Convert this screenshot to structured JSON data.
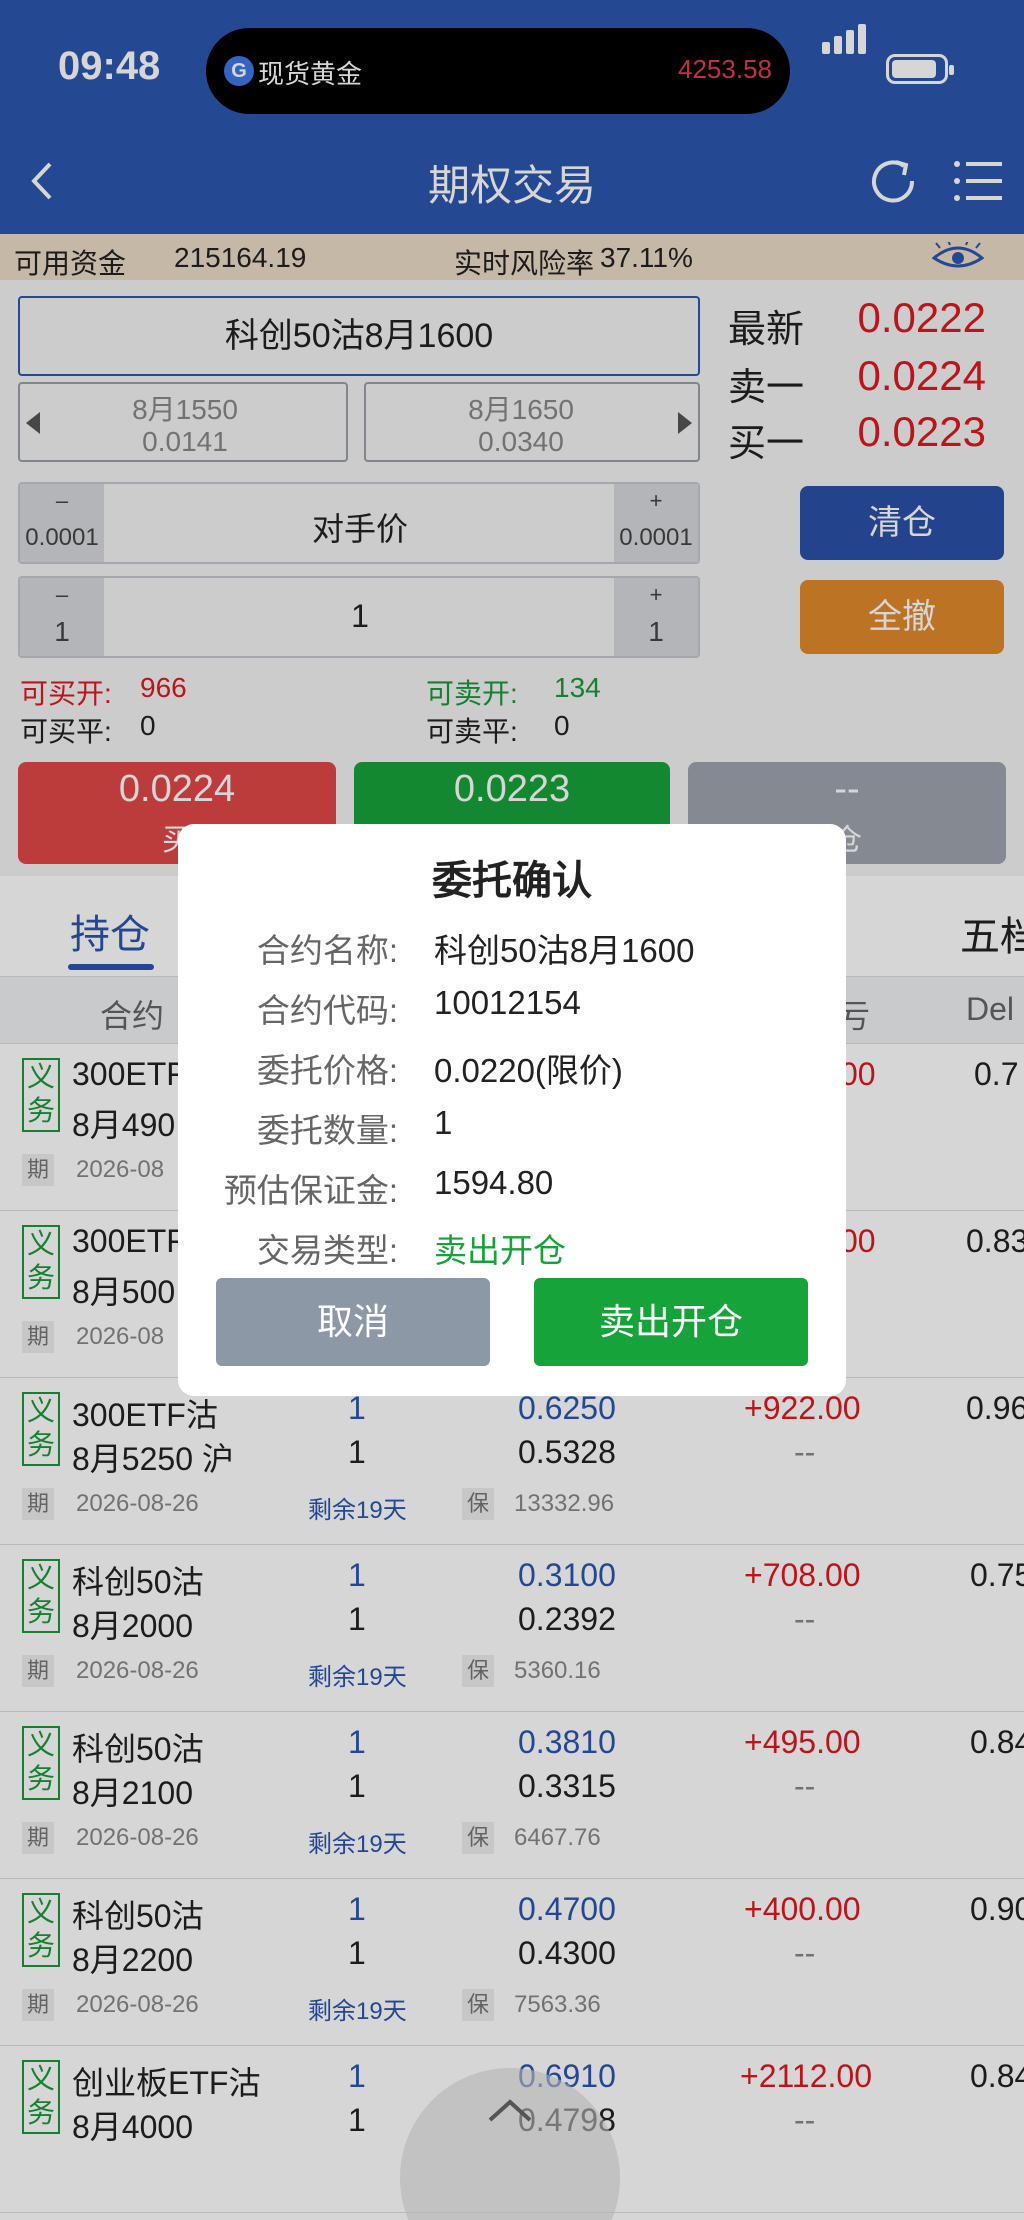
{
  "status": {
    "time": "09:48"
  },
  "island": {
    "label": "现货黄金",
    "price": "4253.58"
  },
  "header": {
    "title": "期权交易"
  },
  "funds": {
    "available_label": "可用资金",
    "available_value": "215164.19",
    "risk_label": "实时风险率",
    "risk_value": "37.11%"
  },
  "contract": {
    "name": "科创50沽8月1600"
  },
  "neighbors": {
    "prev": {
      "strike": "8月1550",
      "price": "0.0141"
    },
    "next": {
      "strike": "8月1650",
      "price": "0.0340"
    }
  },
  "quotes": [
    {
      "label": "最新",
      "value": "0.0222"
    },
    {
      "label": "卖一",
      "value": "0.0224"
    },
    {
      "label": "买一",
      "value": "0.0223"
    }
  ],
  "price_stepper": {
    "minus": "–",
    "minus_step": "0.0001",
    "plus": "+",
    "plus_step": "0.0001",
    "value": "对手价"
  },
  "qty_stepper": {
    "minus": "–",
    "minus_step": "1",
    "plus": "+",
    "plus_step": "1",
    "value": "1"
  },
  "buttons": {
    "close_all": "清仓",
    "cancel_all": "全撤"
  },
  "availability": {
    "buy_open_label": "可买开:",
    "buy_open_value": "966",
    "sell_open_label": "可卖开:",
    "sell_open_value": "134",
    "buy_close_label": "可买平:",
    "buy_close_value": "0",
    "sell_close_label": "可卖平:",
    "sell_close_value": "0"
  },
  "actions": {
    "buy": {
      "price": "0.0224",
      "label": "买"
    },
    "sell": {
      "price": "0.0223",
      "label": ""
    },
    "close": {
      "price": "--",
      "label": "仓"
    }
  },
  "tabs": {
    "positions": "持仓",
    "five_level": "五档"
  },
  "columns": {
    "contract": "合约",
    "pnl": "亏",
    "delta": "Del"
  },
  "positions": [
    {
      "tag_top": "义",
      "tag_bottom": "务",
      "name1": "300ETF",
      "name2": "8月490",
      "qty1": "",
      "qty2": "",
      "price1": "",
      "price2": "",
      "pnl": "00",
      "pnl2": "",
      "delta": "0.7",
      "chip1": "期",
      "expiry": "2026-08",
      "remaining": "",
      "chip2": "",
      "margin": ""
    },
    {
      "tag_top": "义",
      "tag_bottom": "务",
      "name1": "300ETF",
      "name2": "8月500",
      "qty1": "",
      "qty2": "",
      "price1": "",
      "price2": "",
      "pnl": "00",
      "pnl2": "",
      "delta": "0.83",
      "chip1": "期",
      "expiry": "2026-08",
      "remaining": "",
      "chip2": "",
      "margin": ""
    },
    {
      "tag_top": "义",
      "tag_bottom": "务",
      "name1": "300ETF沽",
      "name2": "8月5250 沪",
      "qty1": "1",
      "qty2": "1",
      "price1": "0.6250",
      "price2": "0.5328",
      "pnl": "+922.00",
      "pnl2": "--",
      "delta": "0.96",
      "chip1": "期",
      "expiry": "2026-08-26",
      "remaining": "剩余19天",
      "chip2": "保",
      "margin": "13332.96"
    },
    {
      "tag_top": "义",
      "tag_bottom": "务",
      "name1": "科创50沽",
      "name2": "8月2000",
      "qty1": "1",
      "qty2": "1",
      "price1": "0.3100",
      "price2": "0.2392",
      "pnl": "+708.00",
      "pnl2": "--",
      "delta": "0.75",
      "chip1": "期",
      "expiry": "2026-08-26",
      "remaining": "剩余19天",
      "chip2": "保",
      "margin": "5360.16"
    },
    {
      "tag_top": "义",
      "tag_bottom": "务",
      "name1": "科创50沽",
      "name2": "8月2100",
      "qty1": "1",
      "qty2": "1",
      "price1": "0.3810",
      "price2": "0.3315",
      "pnl": "+495.00",
      "pnl2": "--",
      "delta": "0.84",
      "chip1": "期",
      "expiry": "2026-08-26",
      "remaining": "剩余19天",
      "chip2": "保",
      "margin": "6467.76"
    },
    {
      "tag_top": "义",
      "tag_bottom": "务",
      "name1": "科创50沽",
      "name2": "8月2200",
      "qty1": "1",
      "qty2": "1",
      "price1": "0.4700",
      "price2": "0.4300",
      "pnl": "+400.00",
      "pnl2": "--",
      "delta": "0.90",
      "chip1": "期",
      "expiry": "2026-08-26",
      "remaining": "剩余19天",
      "chip2": "保",
      "margin": "7563.36"
    },
    {
      "tag_top": "义",
      "tag_bottom": "务",
      "name1": "创业板ETF沽",
      "name2": "8月4000",
      "qty1": "1",
      "qty2": "1",
      "price1": "0.6910",
      "price2": "0.4798",
      "pnl": "+2112.00",
      "pnl2": "--",
      "delta": "0.84",
      "chip1": "",
      "expiry": "",
      "remaining": "",
      "chip2": "",
      "margin": ""
    }
  ],
  "dialog": {
    "title": "委托确认",
    "rows": [
      {
        "label": "合约名称:",
        "value": "科创50沽8月1600"
      },
      {
        "label": "合约代码:",
        "value": "10012154"
      },
      {
        "label": "委托价格:",
        "value": "0.0220(限价)"
      },
      {
        "label": "委托数量:",
        "value": "1"
      },
      {
        "label": "预估保证金:",
        "value": "1594.80"
      },
      {
        "label": "交易类型:",
        "value": "卖出开仓"
      }
    ],
    "cancel": "取消",
    "confirm": "卖出开仓"
  },
  "icons": {
    "back": "chevron-left-icon",
    "refresh": "refresh-icon",
    "menu": "menu-icon",
    "eye": "eye-icon",
    "scroll_top": "chevron-up-icon"
  },
  "colors": {
    "header": "#2b57af",
    "buy": "#e04848",
    "sell": "#18a33a",
    "clear": "#2a52a8",
    "cancel_all": "#e08a2c"
  }
}
